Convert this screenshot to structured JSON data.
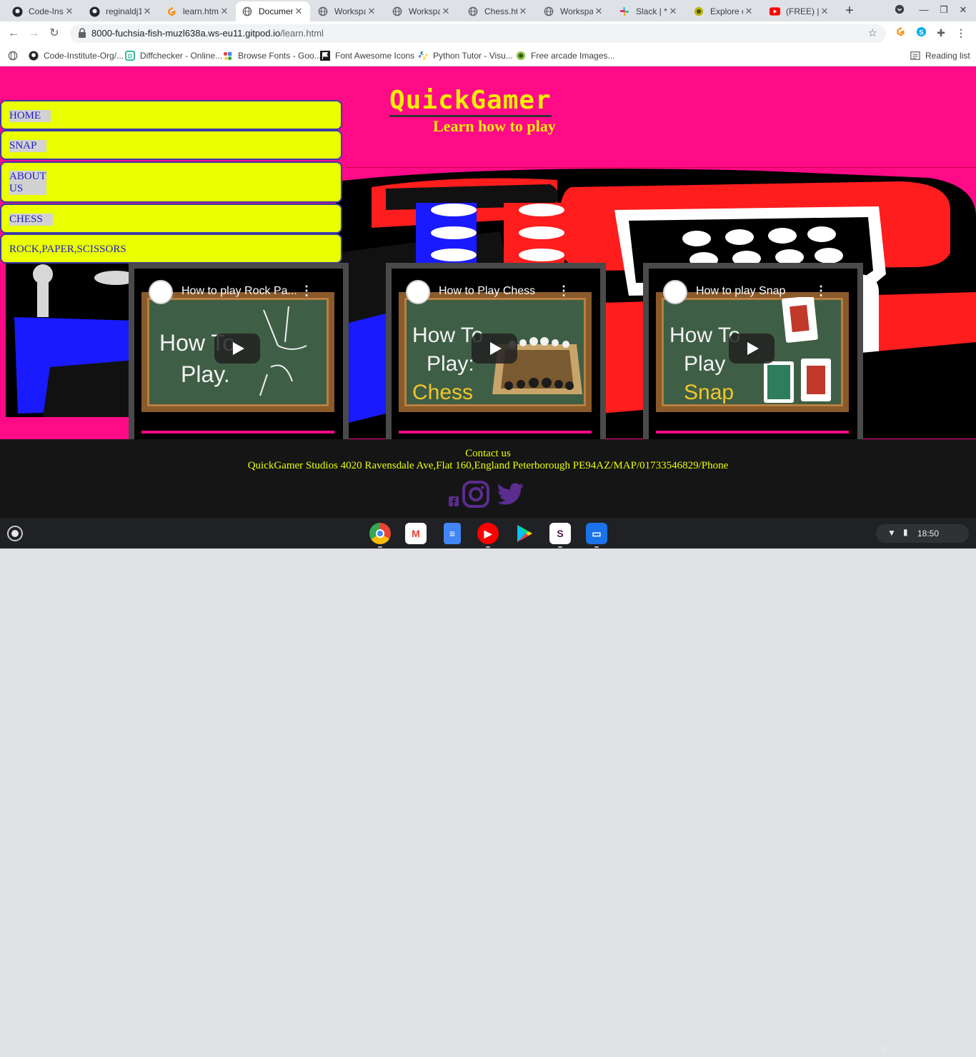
{
  "browser": {
    "tabs": [
      {
        "title": "Code-Insti",
        "icon": "github-icon",
        "active": false
      },
      {
        "title": "reginaldj1",
        "icon": "github-icon",
        "active": false
      },
      {
        "title": "learn.html",
        "icon": "gitpod-icon",
        "active": false
      },
      {
        "title": "Documen",
        "icon": "globe-icon",
        "active": true
      },
      {
        "title": "Workspac",
        "icon": "globe-icon",
        "active": false
      },
      {
        "title": "Workspac",
        "icon": "globe-icon",
        "active": false
      },
      {
        "title": "Chess.htm",
        "icon": "globe-icon",
        "active": false
      },
      {
        "title": "Workspac",
        "icon": "globe-icon",
        "active": false
      },
      {
        "title": "Slack | * M",
        "icon": "slack-icon",
        "active": false
      },
      {
        "title": "Explore ou",
        "icon": "fish-icon",
        "active": false
      },
      {
        "title": "(FREE) | *F",
        "icon": "youtube-icon",
        "active": false
      }
    ],
    "url_host": "8000-fuchsia-fish-muzl638a.ws-eu11.gitpod.io",
    "url_path": "/learn.html",
    "bookmarks": [
      {
        "label": "Code-Institute-Org/...",
        "icon": "github-icon"
      },
      {
        "label": "Diffchecker - Online...",
        "icon": "diffchecker-icon"
      },
      {
        "label": "Browse Fonts - Goo...",
        "icon": "google-fonts-icon"
      },
      {
        "label": "Font Awesome Icons",
        "icon": "flag-icon"
      },
      {
        "label": "Python Tutor - Visu...",
        "icon": "python-icon"
      },
      {
        "label": "Free arcade Images...",
        "icon": "arcade-icon"
      }
    ],
    "reading_list": "Reading list"
  },
  "page": {
    "logo": "QuickGamer",
    "subtitle": "Learn how to play",
    "nav": [
      {
        "label": "HOME"
      },
      {
        "label": "SNAP"
      },
      {
        "label": "ABOUT US"
      },
      {
        "label": "CHESS"
      },
      {
        "label": "ROCK,PAPER,SCISSORS"
      }
    ],
    "videos": [
      {
        "title": "How to play Rock Pa...",
        "line1": "How To",
        "line2": "Play.",
        "line3": ""
      },
      {
        "title": "How to Play Chess",
        "line1": "How To",
        "line2": "Play:",
        "line3": "Chess"
      },
      {
        "title": "How to play Snap",
        "line1": "How To",
        "line2": "Play",
        "line3": "Snap"
      }
    ],
    "footer": {
      "contact": "Contact us",
      "address": "QuickGamer Studios 4020 Ravensdale Ave,Flat 160,England Peterborough PE94AZ/MAP/01733546829/Phone"
    }
  },
  "shelf": {
    "time": "18:50",
    "apps": [
      "chrome-icon",
      "gmail-icon",
      "docs-icon",
      "youtube-icon",
      "play-store-icon",
      "slack-icon",
      "files-icon"
    ]
  }
}
